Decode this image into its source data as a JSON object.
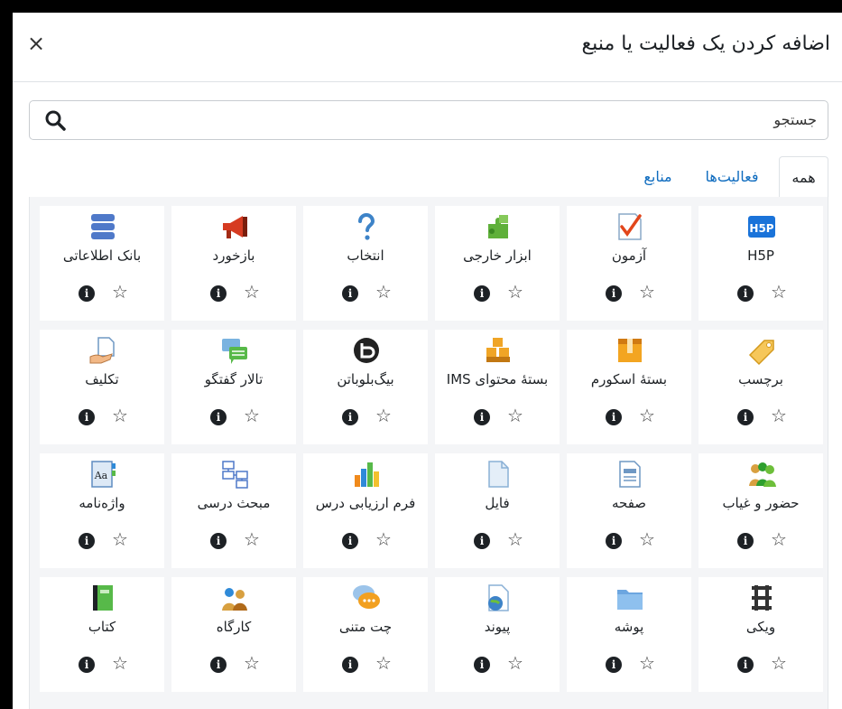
{
  "modal": {
    "title": "اضافه کردن یک فعالیت یا منبع",
    "close": "×"
  },
  "search": {
    "placeholder": "جستجو"
  },
  "tabs": [
    {
      "label": "همه",
      "active": true
    },
    {
      "label": "فعالیت‌ها",
      "active": false
    },
    {
      "label": "منابع",
      "active": false
    }
  ],
  "info_glyph": "i",
  "star_glyph": "☆",
  "items": [
    {
      "label": "H5P",
      "icon": "h5p-icon"
    },
    {
      "label": "آزمون",
      "icon": "quiz-icon"
    },
    {
      "label": "ابزار خارجی",
      "icon": "puzzle-icon"
    },
    {
      "label": "انتخاب",
      "icon": "question-icon"
    },
    {
      "label": "بازخورد",
      "icon": "megaphone-icon"
    },
    {
      "label": "بانک اطلاعاتی",
      "icon": "database-icon"
    },
    {
      "label": "برچسب",
      "icon": "tag-icon"
    },
    {
      "label": "بستهٔ اسکورم",
      "icon": "package-icon"
    },
    {
      "label": "بستهٔ محتوای IMS",
      "icon": "boxes-icon"
    },
    {
      "label": "بیگ‌بلوباتن",
      "icon": "bigbluebutton-icon"
    },
    {
      "label": "تالار گفتگو",
      "icon": "forum-icon"
    },
    {
      "label": "تکلیف",
      "icon": "assignment-icon"
    },
    {
      "label": "حضور و غیاب",
      "icon": "attendance-icon"
    },
    {
      "label": "صفحه",
      "icon": "page-icon"
    },
    {
      "label": "فایل",
      "icon": "file-icon"
    },
    {
      "label": "فرم ارزیابی درس",
      "icon": "bar-chart-icon"
    },
    {
      "label": "مبحث درسی",
      "icon": "lesson-icon"
    },
    {
      "label": "واژه‌نامه",
      "icon": "glossary-icon"
    },
    {
      "label": "ویکی",
      "icon": "wiki-icon"
    },
    {
      "label": "پوشه",
      "icon": "folder-icon"
    },
    {
      "label": "پیوند",
      "icon": "url-icon"
    },
    {
      "label": "چت متنی",
      "icon": "chat-icon"
    },
    {
      "label": "کارگاه",
      "icon": "workshop-icon"
    },
    {
      "label": "کتاب",
      "icon": "book-icon"
    }
  ]
}
